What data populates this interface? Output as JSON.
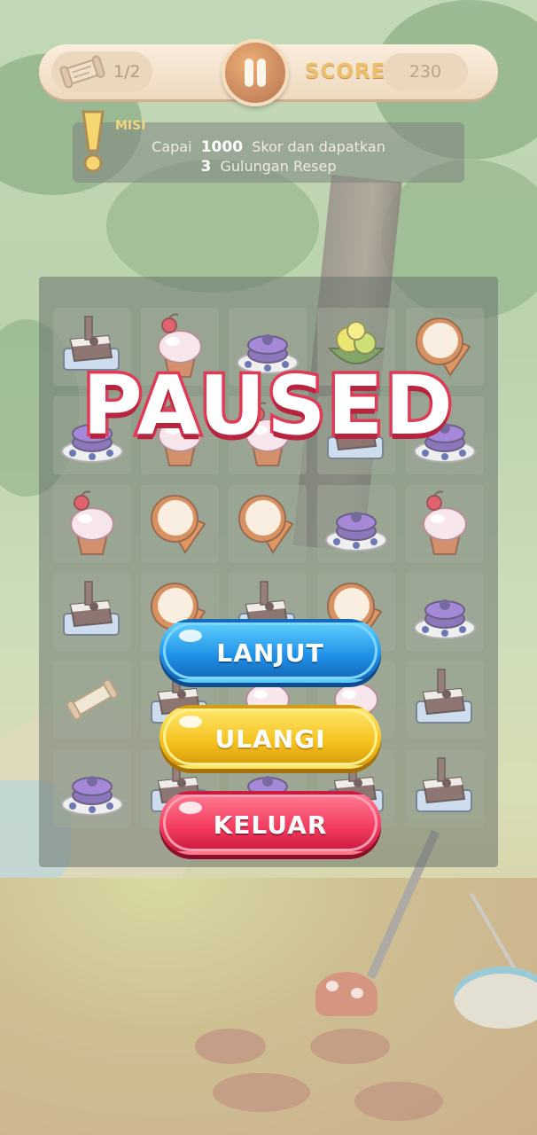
{
  "hud": {
    "scroll_count": "1/2",
    "score_label": "SCORE",
    "score_value": "230"
  },
  "mission": {
    "title": "MISI",
    "line1_pre": "Capai",
    "line1_value": "1000",
    "line1_post": "Skor dan dapatkan",
    "line2_value": "3",
    "line2_post": "Gulungan Resep"
  },
  "board": {
    "rows": [
      [
        "cake",
        "cupcake",
        "pancake",
        "lemon",
        "coconut"
      ],
      [
        "pancake",
        "cupcake",
        "cupcake",
        "cake",
        "pancake"
      ],
      [
        "cupcake",
        "coconut",
        "coconut",
        "pancake",
        "cupcake"
      ],
      [
        "cake",
        "coconut",
        "cake",
        "coconut",
        "pancake"
      ],
      [
        "scroll",
        "cake",
        "cupcake",
        "cupcake",
        "cake"
      ],
      [
        "pancake",
        "cake",
        "pancake",
        "cake",
        "cake"
      ]
    ]
  },
  "pause_menu": {
    "title": "PAUSED",
    "resume_label": "LANJUT",
    "restart_label": "ULANGI",
    "exit_label": "KELUAR"
  },
  "colors": {
    "title_stroke": "#e03a56",
    "resume": "#1f8fe6",
    "restart": "#f5c21f",
    "exit": "#f33a5e",
    "score_label": "#e7a42c"
  }
}
